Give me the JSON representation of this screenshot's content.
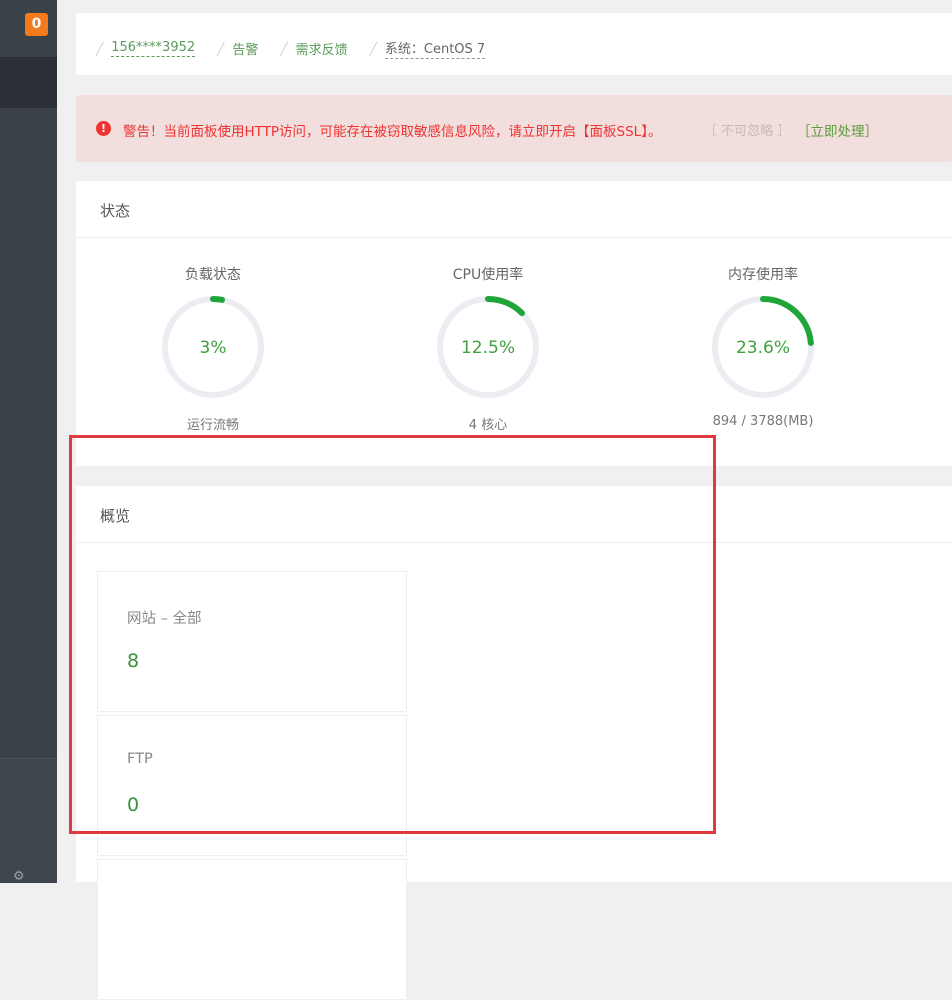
{
  "sidebar": {
    "badge": "0",
    "settings_icon": "gear-icon"
  },
  "header": {
    "crumbs": [
      {
        "text": "156****3952"
      },
      {
        "text": "告警"
      },
      {
        "text": "需求反馈"
      },
      {
        "text": "系统：CentOS 7"
      }
    ]
  },
  "alert": {
    "icon": "exclamation-icon",
    "message": "警告！当前面板使用HTTP访问，可能存在被窃取敏感信息风险，请立即开启【面板SSL】。",
    "ignore": "［ 不可忽略 ］",
    "fix": "［立即处理］"
  },
  "status": {
    "title": "状态",
    "gauges": [
      {
        "label": "负载状态",
        "value": "3%",
        "sub": "运行流畅",
        "percent": 3
      },
      {
        "label": "CPU使用率",
        "value": "12.5%",
        "sub": "4 核心",
        "percent": 12.5
      },
      {
        "label": "内存使用率",
        "value": "23.6%",
        "sub": "894 / 3788(MB)",
        "percent": 23.6
      }
    ]
  },
  "overview": {
    "title": "概览",
    "items": [
      {
        "label": "网站 – 全部",
        "value": "8"
      },
      {
        "label": "FTP",
        "value": "0"
      }
    ]
  },
  "colors": {
    "accent": "#20a53a",
    "danger": "#e33333",
    "badge": "#f37b1d"
  }
}
